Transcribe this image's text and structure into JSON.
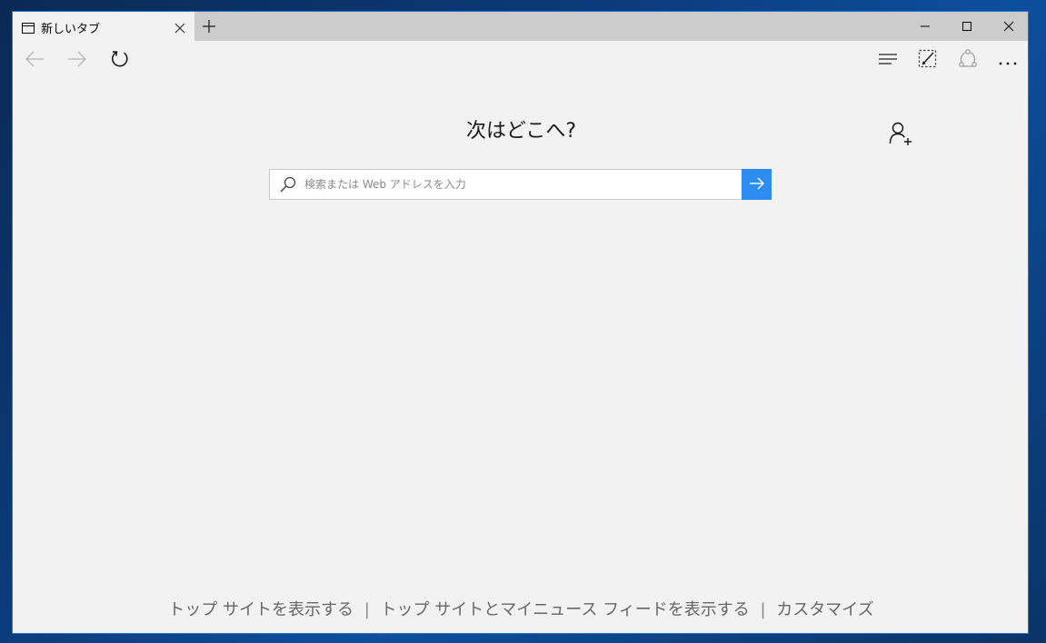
{
  "tab": {
    "title": "新しいタブ",
    "icon": "tab-page-icon"
  },
  "window_controls": [
    "minimize-icon",
    "maximize-icon",
    "close-icon"
  ],
  "nav": {
    "icons": [
      "back-arrow-icon",
      "forward-arrow-icon",
      "refresh-icon",
      "hub-icon",
      "web-note-icon",
      "share-icon",
      "more-icon"
    ]
  },
  "main": {
    "heading": "次はどこへ?",
    "search_placeholder": "検索または Web アドレスを入力"
  },
  "footer": {
    "link1": "トップ サイトを表示する",
    "separator": "|",
    "link2": "トップ サイトとマイニュース フィードを表示する",
    "link3": "カスタマイズ"
  },
  "colors": {
    "accent": "#2d8cf0",
    "page_bg": "#f2f2f2",
    "titlebar_bg": "#cccccc",
    "window_border": "#2b73c7"
  }
}
